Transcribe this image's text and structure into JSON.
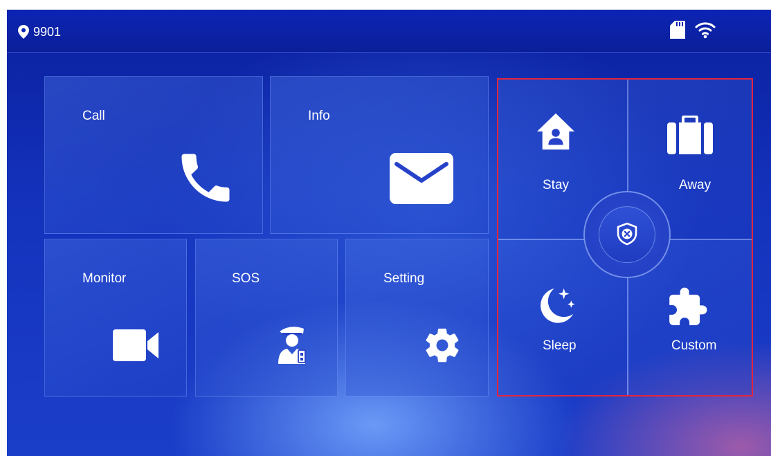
{
  "status_bar": {
    "device_id": "9901",
    "icons": [
      "location-pin-icon",
      "sd-card-icon",
      "wifi-icon"
    ]
  },
  "tiles": {
    "call": {
      "label": "Call",
      "icon": "phone-icon"
    },
    "info": {
      "label": "Info",
      "icon": "envelope-icon"
    },
    "monitor": {
      "label": "Monitor",
      "icon": "video-camera-icon"
    },
    "sos": {
      "label": "SOS",
      "icon": "security-guard-icon"
    },
    "setting": {
      "label": "Setting",
      "icon": "gear-icon"
    }
  },
  "alarm_modes": {
    "stay": {
      "label": "Stay",
      "icon": "house-person-icon"
    },
    "away": {
      "label": "Away",
      "icon": "briefcase-icon"
    },
    "sleep": {
      "label": "Sleep",
      "icon": "moon-stars-icon"
    },
    "custom": {
      "label": "Custom",
      "icon": "puzzle-icon"
    },
    "disarm": {
      "icon": "shield-x-icon"
    }
  },
  "colors": {
    "background": "#1433bd",
    "status_bar": "#0c24b5",
    "highlight_border": "#e3253d",
    "text": "#ffffff"
  }
}
